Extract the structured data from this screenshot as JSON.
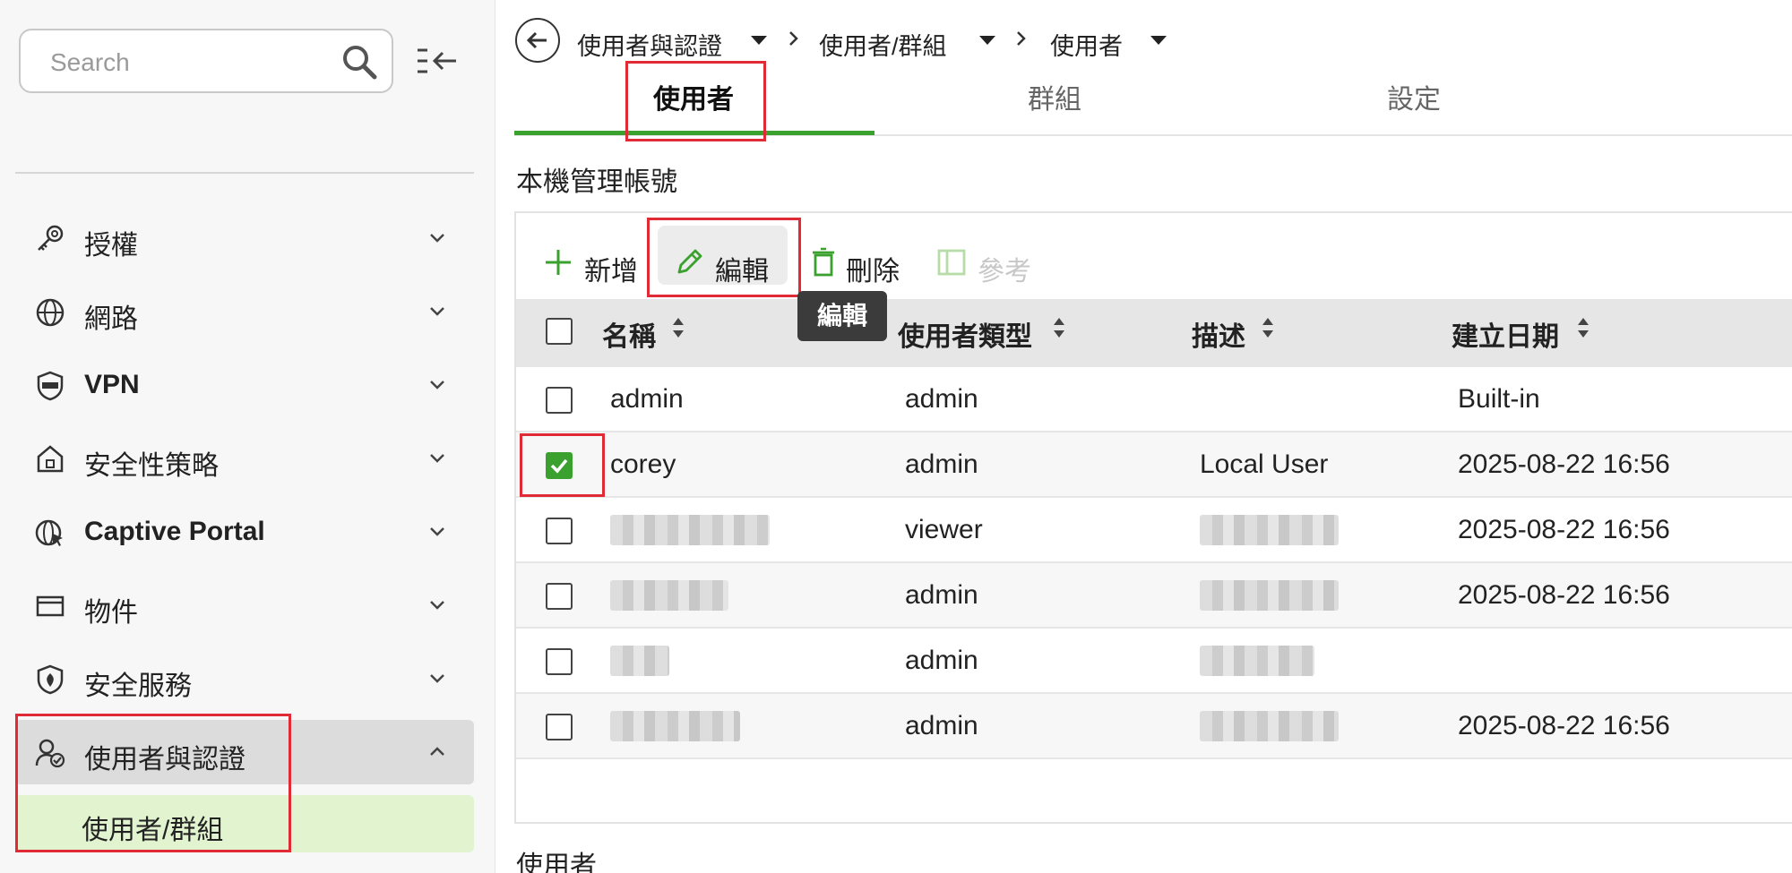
{
  "search": {
    "placeholder": "Search"
  },
  "sidebar": {
    "items": [
      {
        "label": "授權",
        "icon": "key-icon"
      },
      {
        "label": "網路",
        "icon": "globe-icon"
      },
      {
        "label": "VPN",
        "icon": "vpn-shield-icon"
      },
      {
        "label": "安全性策略",
        "icon": "policy-icon"
      },
      {
        "label": "Captive Portal",
        "icon": "captive-portal-icon"
      },
      {
        "label": "物件",
        "icon": "object-icon"
      },
      {
        "label": "安全服務",
        "icon": "security-service-icon"
      },
      {
        "label": "使用者與認證",
        "icon": "user-auth-icon"
      }
    ],
    "sub_item": "使用者/群組"
  },
  "breadcrumb": [
    "使用者與認證",
    "使用者/群組",
    "使用者"
  ],
  "tabs": [
    "使用者",
    "群組",
    "設定"
  ],
  "section_title": "本機管理帳號",
  "toolbar": {
    "add": "新增",
    "edit": "編輯",
    "delete": "刪除",
    "reference": "參考"
  },
  "tooltip": "編輯",
  "table": {
    "headers": [
      "名稱",
      "使用者類型",
      "描述",
      "建立日期"
    ],
    "rows": [
      {
        "name": "admin",
        "type": "admin",
        "description": "",
        "created": "Built-in",
        "checked": false
      },
      {
        "name": "corey",
        "type": "admin",
        "description": "Local User",
        "created": "2025-08-22 16:56",
        "checked": true
      },
      {
        "name": "",
        "type": "viewer",
        "description": "",
        "created": "2025-08-22 16:56",
        "checked": false
      },
      {
        "name": "",
        "type": "admin",
        "description": "",
        "created": "2025-08-22 16:56",
        "checked": false
      },
      {
        "name": "",
        "type": "admin",
        "description": "",
        "created": "",
        "checked": false
      },
      {
        "name": "",
        "type": "admin",
        "description": "",
        "created": "2025-08-22 16:56",
        "checked": false
      }
    ]
  },
  "bottom_section_title": "使用者",
  "colors": {
    "accent_green": "#3aa12e",
    "highlight_red": "#e02b36",
    "sub_item_bg": "#e1f3cf"
  }
}
